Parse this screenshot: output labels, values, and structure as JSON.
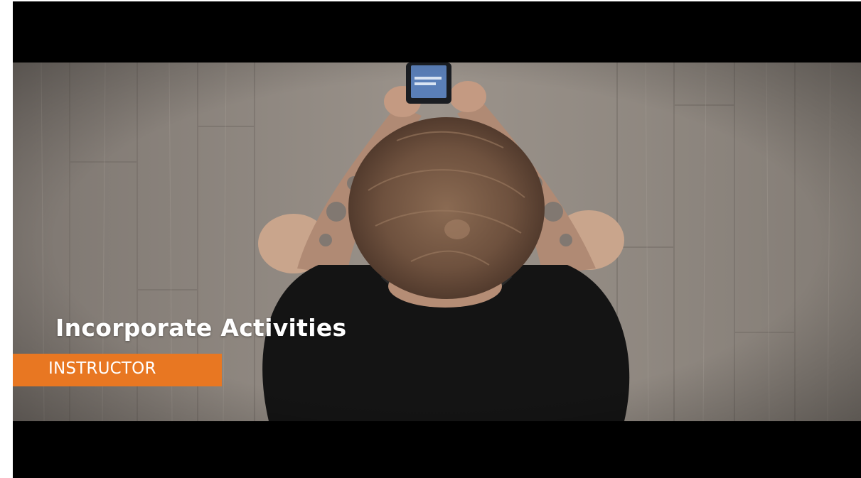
{
  "video": {
    "title": "Incorporate Activities",
    "role": "INSTRUCTOR"
  },
  "colors": {
    "letterbox": "#000000",
    "badge": "#e87722",
    "text": "#ffffff",
    "floor": "#8f8780"
  },
  "scene": {
    "subject": "person-holding-phone-top-view"
  }
}
